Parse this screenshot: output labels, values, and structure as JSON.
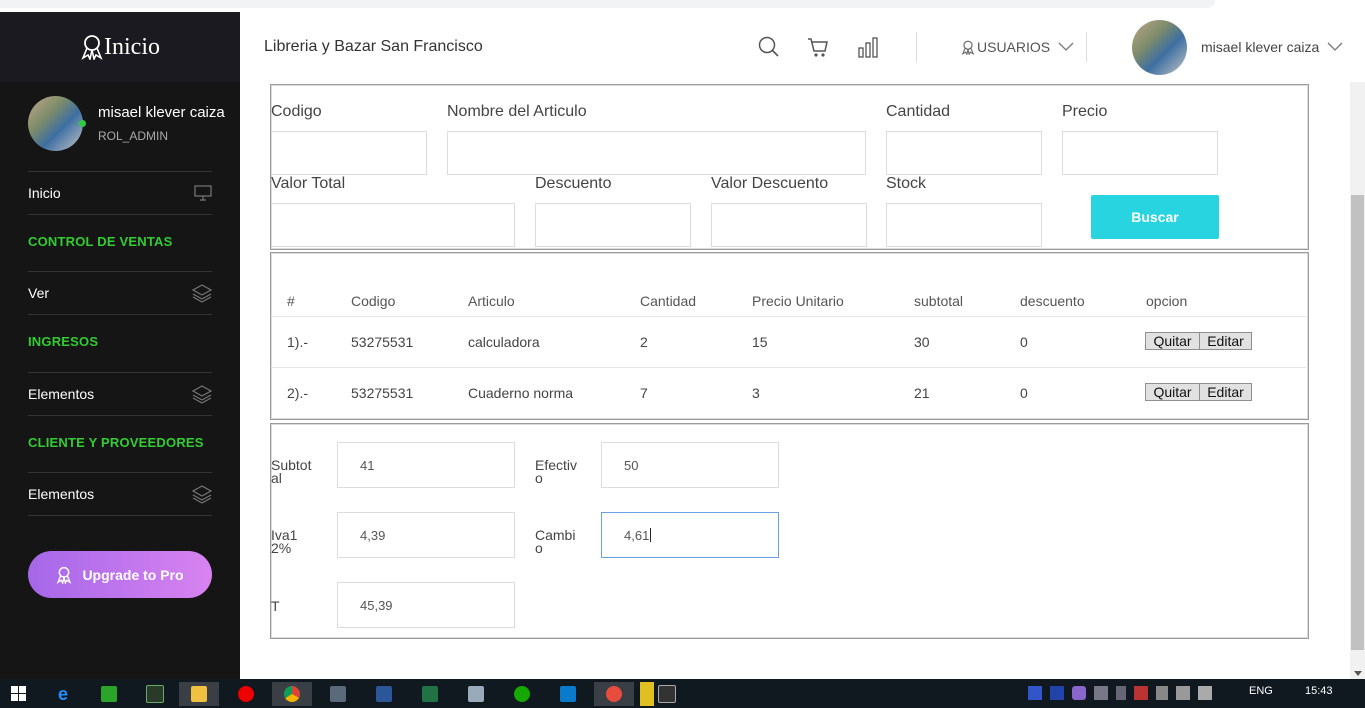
{
  "sidebar": {
    "brand": "Inicio",
    "user_name": "misael klever caiza",
    "user_role": "ROL_ADMIN",
    "item_inicio": "Inicio",
    "head_ventas": "CONTROL DE VENTAS",
    "item_ver": "Ver",
    "head_ingresos": "INGRESOS",
    "item_elementos_1": "Elementos",
    "head_clientes": "CLIENTE Y PROVEEDORES",
    "item_elementos_2": "Elementos",
    "upgrade": "Upgrade to Pro"
  },
  "topbar": {
    "store": "Libreria y Bazar San Francisco",
    "usuarios": "USUARIOS",
    "user_name": "misael klever caiza"
  },
  "form": {
    "codigo": "Codigo",
    "nombre": "Nombre del Articulo",
    "cantidad": "Cantidad",
    "precio": "Precio",
    "valor_total": "Valor Total",
    "descuento": "Descuento",
    "valor_descuento": "Valor Descuento",
    "stock": "Stock",
    "buscar": "Buscar"
  },
  "table": {
    "headers": [
      "#",
      "Codigo",
      "Articulo",
      "Cantidad",
      "Precio Unitario",
      "subtotal",
      "descuento",
      "opcion"
    ],
    "rows": [
      {
        "n": "1).-",
        "codigo": "53275531",
        "articulo": "calculadora",
        "cantidad": "2",
        "precio": "15",
        "subtotal": "30",
        "descuento": "0"
      },
      {
        "n": "2).-",
        "codigo": "53275531",
        "articulo": "Cuaderno norma",
        "cantidad": "7",
        "precio": "3",
        "subtotal": "21",
        "descuento": "0"
      }
    ],
    "quitar": "Quitar",
    "editar": "Editar"
  },
  "summary": {
    "subtotal_label": "Subtotal",
    "subtotal": "41",
    "efectivo_label": "Efectivo",
    "efectivo": "50",
    "iva_label": "Iva12%",
    "iva": "4,39",
    "cambio_label": "Cambio",
    "cambio": "4,61",
    "total_label": "T",
    "total": "45,39"
  },
  "taskbar": {
    "lang": "ENG",
    "time": "15:43"
  },
  "colors": {
    "sidebar_bg": "#151515",
    "section_green": "#33cc33",
    "buscar_button": "#27d4e0",
    "upgrade_gradient": [
      "#a567e8",
      "#d883f0"
    ]
  },
  "icons": [
    "user-award-icon",
    "monitor-icon",
    "layers-icon",
    "search-icon",
    "cart-icon",
    "bar-chart-icon",
    "chevron-down-icon",
    "windows-start-icon"
  ]
}
